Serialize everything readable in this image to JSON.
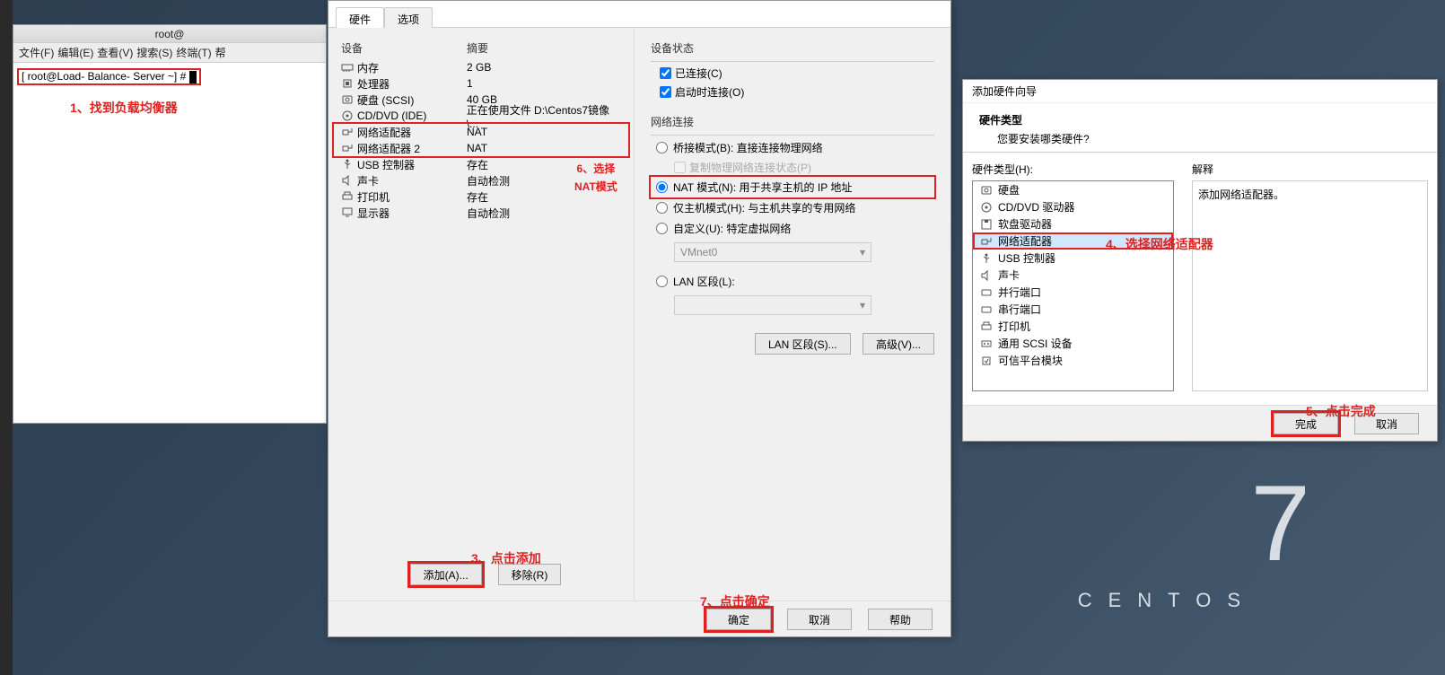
{
  "desktop": {
    "centos_text": "CENTOS",
    "centos_num": "7"
  },
  "terminal": {
    "title": "root@",
    "menus": [
      "文件(F)",
      "编辑(E)",
      "查看(V)",
      "搜索(S)",
      "终端(T)",
      "帮"
    ],
    "prompt": "[ root@Load- Balance- Server  ~] #"
  },
  "annotations": {
    "a1": "1、找到负载均衡器",
    "a3": "3、点击添加",
    "a4": "4、选择网络适配器",
    "a5": "5、点击完成",
    "a6_l1": "6、选择",
    "a6_l2": "NAT模式",
    "a7": "7、点击确定"
  },
  "settings": {
    "tabs": {
      "hw": "硬件",
      "opt": "选项"
    },
    "headers": {
      "device": "设备",
      "summary": "摘要"
    },
    "rows": [
      {
        "name": "内存",
        "summary": "2 GB",
        "icon": "mem"
      },
      {
        "name": "处理器",
        "summary": "1",
        "icon": "cpu"
      },
      {
        "name": "硬盘 (SCSI)",
        "summary": "40 GB",
        "icon": "hdd"
      },
      {
        "name": "CD/DVD (IDE)",
        "summary": "正在使用文件 D:\\Centos7镜像\\...",
        "icon": "cd"
      },
      {
        "name": "网络适配器",
        "summary": "NAT",
        "icon": "net",
        "hl": true
      },
      {
        "name": "网络适配器 2",
        "summary": "NAT",
        "icon": "net",
        "hl": true
      },
      {
        "name": "USB 控制器",
        "summary": "存在",
        "icon": "usb"
      },
      {
        "name": "声卡",
        "summary": "自动检测",
        "icon": "snd"
      },
      {
        "name": "打印机",
        "summary": "存在",
        "icon": "prn"
      },
      {
        "name": "显示器",
        "summary": "自动检测",
        "icon": "disp"
      }
    ],
    "add_btn": "添加(A)...",
    "remove_btn": "移除(R)",
    "dev_status": {
      "title": "设备状态",
      "connected": "已连接(C)",
      "on_power": "启动时连接(O)"
    },
    "net_conn": {
      "title": "网络连接",
      "bridged": "桥接模式(B): 直接连接物理网络",
      "replicate": "复制物理网络连接状态(P)",
      "nat": "NAT 模式(N): 用于共享主机的 IP 地址",
      "hostonly": "仅主机模式(H): 与主机共享的专用网络",
      "custom": "自定义(U): 特定虚拟网络",
      "custom_sel": "VMnet0",
      "lan": "LAN 区段(L):"
    },
    "lan_btn": "LAN 区段(S)...",
    "adv_btn": "高级(V)...",
    "ok": "确定",
    "cancel": "取消",
    "help": "帮助"
  },
  "wizard": {
    "title": "添加硬件向导",
    "banner_h": "硬件类型",
    "banner_s": "您要安装哪类硬件?",
    "left_label": "硬件类型(H):",
    "items": [
      {
        "name": "硬盘",
        "icon": "hdd"
      },
      {
        "name": "CD/DVD 驱动器",
        "icon": "cd"
      },
      {
        "name": "软盘驱动器",
        "icon": "floppy"
      },
      {
        "name": "网络适配器",
        "icon": "net",
        "sel": true
      },
      {
        "name": "USB 控制器",
        "icon": "usb"
      },
      {
        "name": "声卡",
        "icon": "snd"
      },
      {
        "name": "并行端口",
        "icon": "port"
      },
      {
        "name": "串行端口",
        "icon": "port"
      },
      {
        "name": "打印机",
        "icon": "prn"
      },
      {
        "name": "通用 SCSI 设备",
        "icon": "scsi"
      },
      {
        "name": "可信平台模块",
        "icon": "tpm"
      }
    ],
    "right_label": "解释",
    "desc": "添加网络适配器。",
    "finish": "完成",
    "cancel": "取消"
  }
}
